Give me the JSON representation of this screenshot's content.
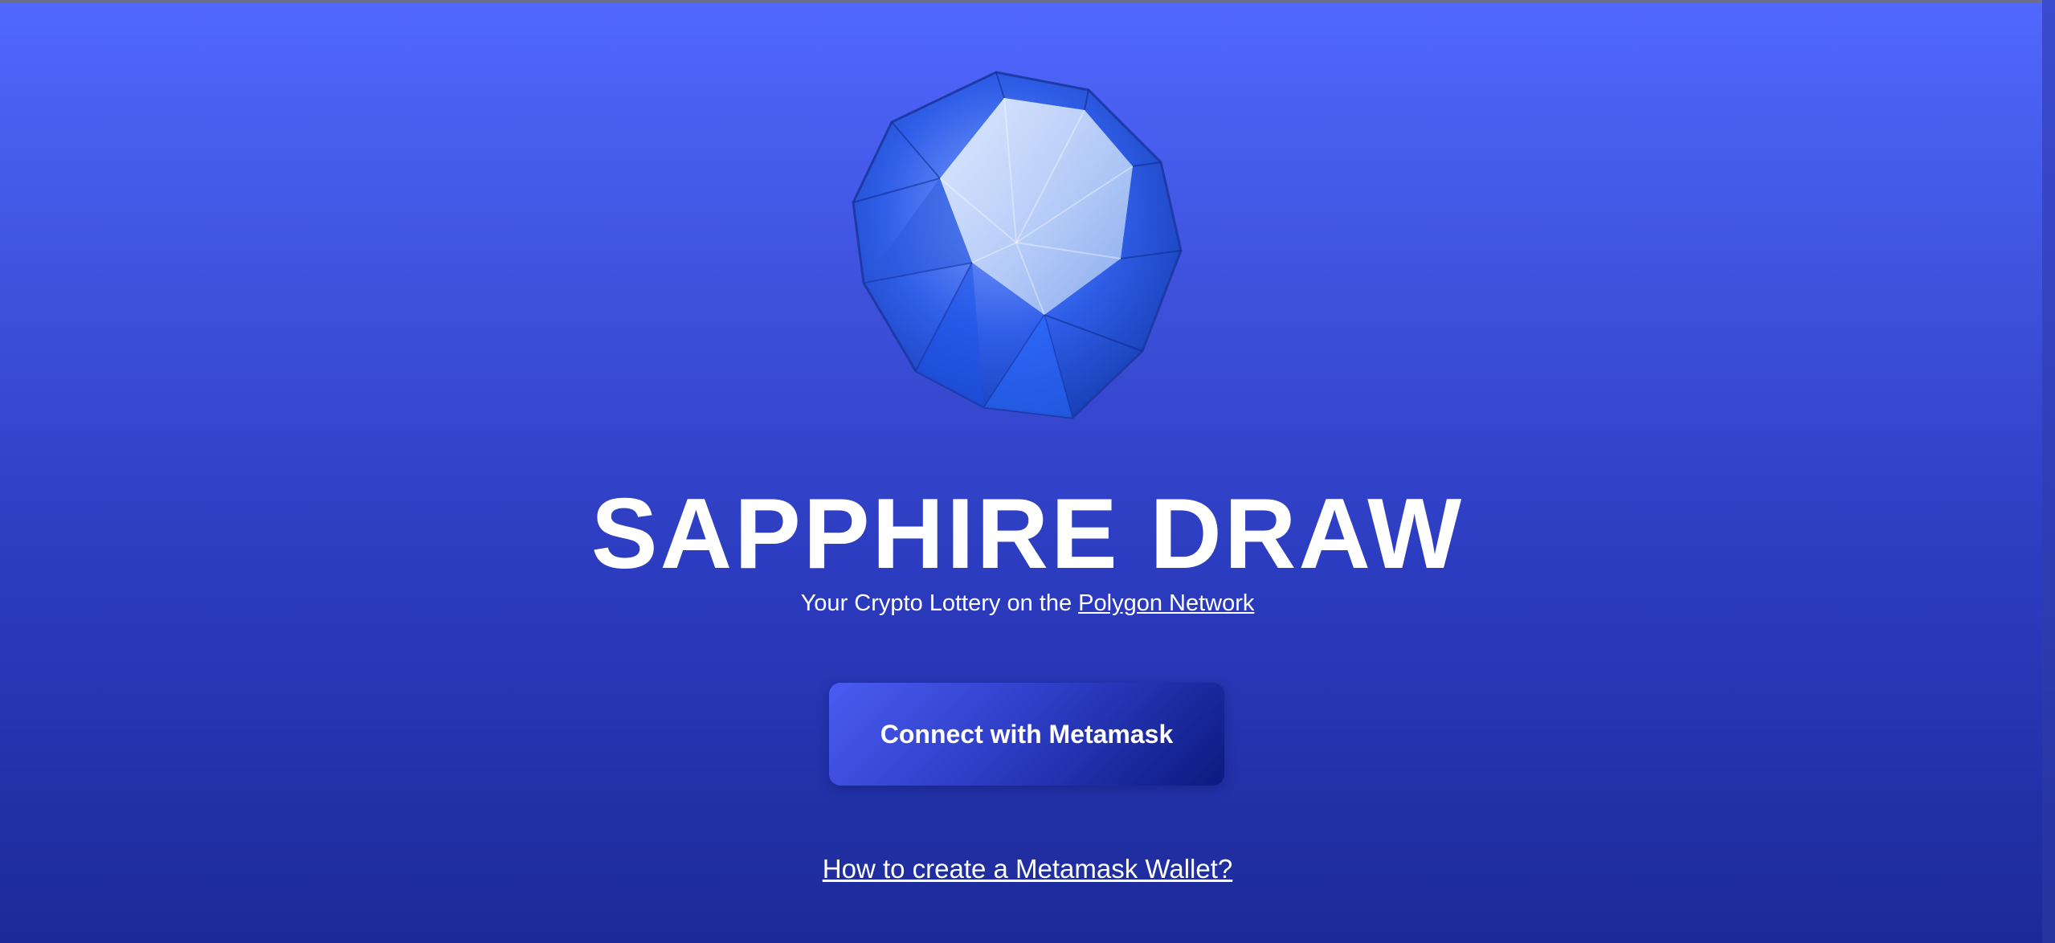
{
  "brand": {
    "title": "SAPPHIRE DRAW",
    "logo_icon": "sapphire-gem-icon"
  },
  "subtitle": {
    "prefix": "Your Crypto Lottery on the ",
    "link_text": "Polygon Network"
  },
  "actions": {
    "connect_label": "Connect with Metamask",
    "help_link_text": "How to create a Metamask Wallet?"
  },
  "colors": {
    "background_top": "#5168ff",
    "background_bottom": "#1c2a98",
    "button_start": "#4a5cf2",
    "button_end": "#0c1a80",
    "text": "#ffffff"
  }
}
